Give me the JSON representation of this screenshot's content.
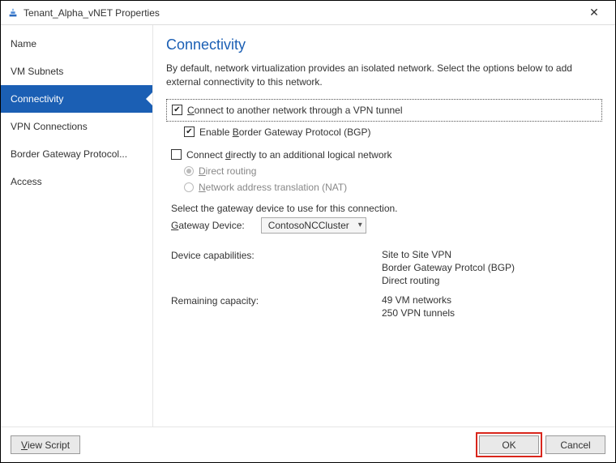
{
  "window": {
    "title": "Tenant_Alpha_vNET Properties"
  },
  "sidebar": {
    "items": [
      {
        "label": "Name"
      },
      {
        "label": "VM Subnets"
      },
      {
        "label": "Connectivity"
      },
      {
        "label": "VPN Connections"
      },
      {
        "label": "Border Gateway Protocol..."
      },
      {
        "label": "Access"
      }
    ]
  },
  "page": {
    "title": "Connectivity",
    "description": "By default, network virtualization provides an isolated network. Select the options below to add external connectivity to this network.",
    "opt_vpn": {
      "label_pre": "C",
      "label_rest": "onnect to another network through a VPN tunnel",
      "checked": true
    },
    "opt_bgp": {
      "label_pre": "Enable ",
      "label_accel": "B",
      "label_rest": "order Gateway Protocol (BGP)",
      "checked": true
    },
    "opt_direct": {
      "label_pre": "Connect ",
      "label_accel": "d",
      "label_rest": "irectly to an additional logical network",
      "checked": false
    },
    "radio_direct": {
      "label_accel": "D",
      "label_rest": "irect routing",
      "selected": true
    },
    "radio_nat": {
      "label_accel": "N",
      "label_rest": "etwork address translation (NAT)",
      "selected": false
    },
    "gateway_prompt": "Select the gateway device to use for this connection.",
    "gateway_label_accel": "G",
    "gateway_label_rest": "ateway Device:",
    "gateway_value": "ContosoNCCluster",
    "caps_label": "Device capabilities:",
    "caps": [
      "Site to Site VPN",
      "Border Gateway Protcol (BGP)",
      "Direct routing"
    ],
    "remaining_label": "Remaining capacity:",
    "remaining": [
      "49 VM networks",
      "250 VPN tunnels"
    ]
  },
  "footer": {
    "view_script_accel": "V",
    "view_script_rest": "iew Script",
    "ok": "OK",
    "cancel": "Cancel"
  }
}
